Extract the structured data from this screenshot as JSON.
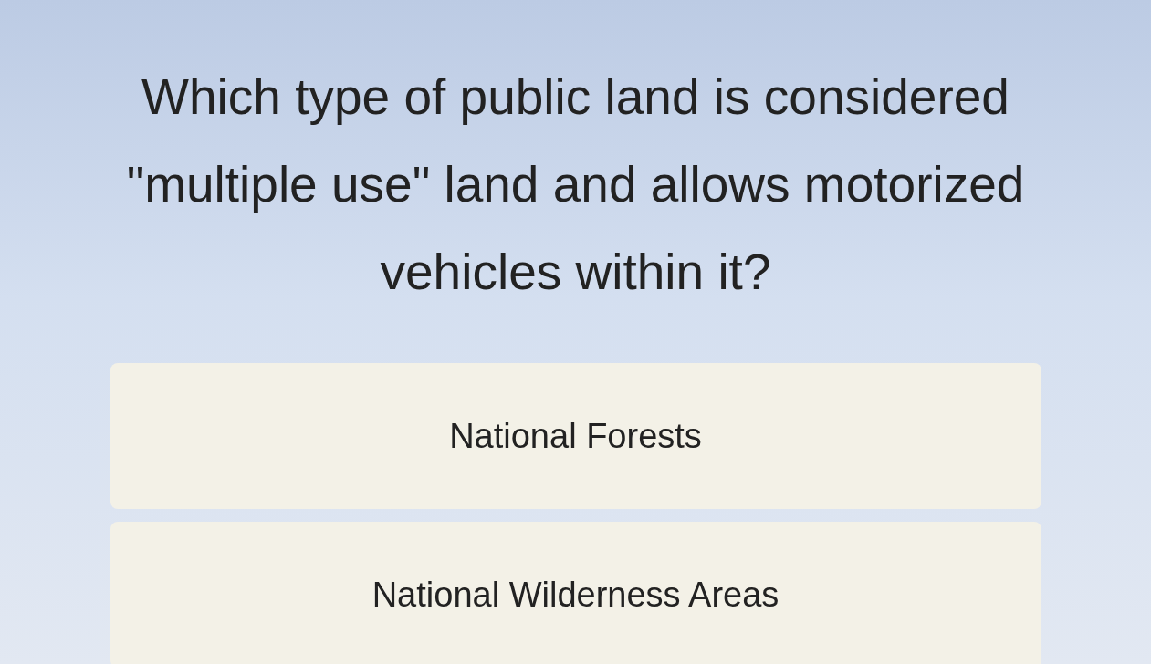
{
  "question": "Which type of public land is considered \"multiple use\" land and allows motorized vehicles within it?",
  "answers": [
    {
      "label": "National Forests"
    },
    {
      "label": "National Wilderness Areas"
    }
  ]
}
